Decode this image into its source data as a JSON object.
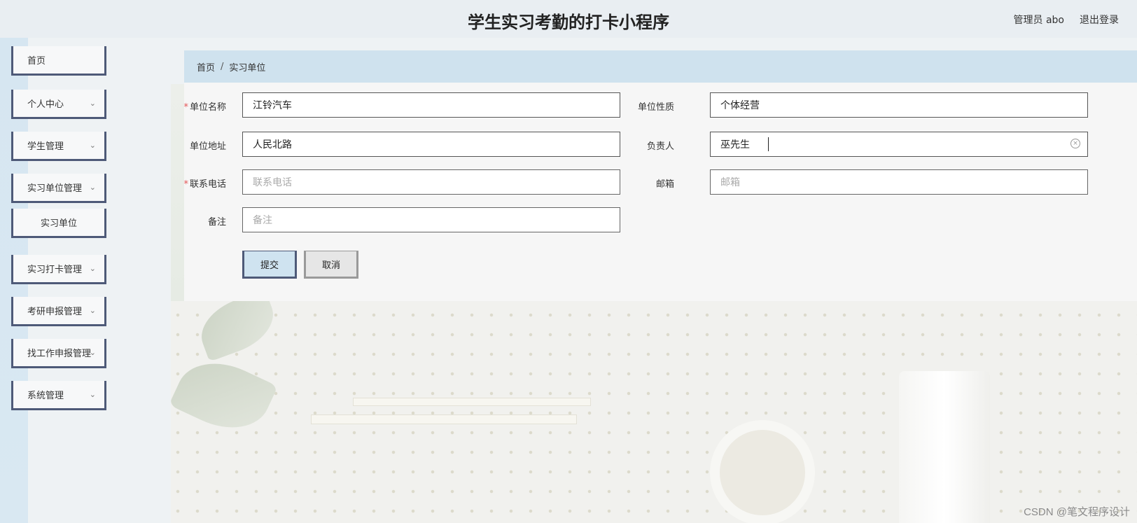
{
  "header": {
    "title": "学生实习考勤的打卡小程序",
    "user": "管理员 abo",
    "logout": "退出登录"
  },
  "sidebar": {
    "items": [
      {
        "label": "首页",
        "has_chevron": false
      },
      {
        "label": "个人中心",
        "has_chevron": true
      },
      {
        "label": "学生管理",
        "has_chevron": true
      },
      {
        "label": "实习单位管理",
        "has_chevron": true
      },
      {
        "label": "实习单位",
        "has_chevron": false,
        "submenu": true
      },
      {
        "label": "实习打卡管理",
        "has_chevron": true
      },
      {
        "label": "考研申报管理",
        "has_chevron": true
      },
      {
        "label": "找工作申报管理",
        "has_chevron": true
      },
      {
        "label": "系统管理",
        "has_chevron": true
      }
    ]
  },
  "breadcrumb": {
    "home": "首页",
    "separator": "/",
    "current": "实习单位"
  },
  "form": {
    "unit_name": {
      "label": "单位名称",
      "required": true,
      "value": "江铃汽车"
    },
    "unit_nature": {
      "label": "单位性质",
      "required": false,
      "value": "个体经营"
    },
    "unit_address": {
      "label": "单位地址",
      "required": false,
      "value": "人民北路"
    },
    "person_in_charge": {
      "label": "负责人",
      "required": false,
      "value": "巫先生"
    },
    "phone": {
      "label": "联系电话",
      "required": true,
      "value": "",
      "placeholder": "联系电话"
    },
    "email": {
      "label": "邮箱",
      "required": false,
      "value": "",
      "placeholder": "邮箱"
    },
    "remark": {
      "label": "备注",
      "required": false,
      "value": "",
      "placeholder": "备注"
    }
  },
  "buttons": {
    "submit": "提交",
    "cancel": "取消"
  },
  "watermark": "CSDN @笔文程序设计",
  "colors": {
    "accent": "#4e5a78",
    "breadcrumb_bg": "#cfe2ee",
    "required": "#e25555"
  }
}
